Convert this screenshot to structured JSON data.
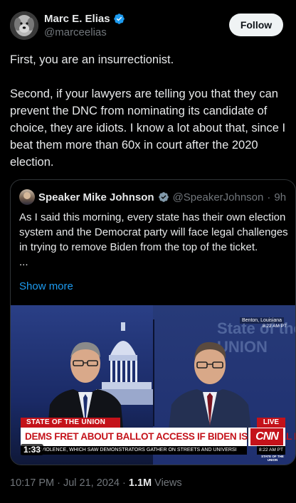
{
  "author": {
    "name": "Marc E. Elias",
    "handle": "@marceelias",
    "verified": true,
    "avatar_icon": "dog-avatar-icon"
  },
  "follow_label": "Follow",
  "tweet": {
    "paragraphs": [
      "First, you are an insurrectionist.",
      "Second, if your lawyers are telling you that they can prevent the DNC from nominating its candidate of choice, they are idiots. I know a lot about that, since I beat them more than 60x in court after the 2020 election."
    ]
  },
  "quote": {
    "name": "Speaker Mike Johnson",
    "handle": "@SpeakerJohnson",
    "separator": "·",
    "age": "9h",
    "text": "As I said this morning, every state has their own election system and the Democrat party will face legal challenges in trying to remove Biden from the top of the ticket.",
    "ellipsis": "...",
    "show_more": "Show more",
    "video": {
      "location": "Benton, Louisiana",
      "small_time": "8:22 AM PT",
      "bg_text": "State of the UNION",
      "show_tag": "STATE OF THE UNION",
      "live_tag": "LIVE",
      "headline": "DEMS FRET ABOUT BALLOT ACCESS IF BIDEN ISN'T FINAL NOMINEE",
      "network": "CNN",
      "ticker": "N THE VIOLENCE, WHICH SAW DEMONSTRATORS GATHER ON STREETS AND UNIVERSI",
      "ticker_time": "8:22 AM PT",
      "sotu_small": "STATE OF THE UNION",
      "duration": "1:33"
    }
  },
  "meta": {
    "time": "10:17 PM",
    "date": "Jul 21, 2024",
    "views_count": "1.1M",
    "views_label": "Views"
  },
  "colors": {
    "background": "#000000",
    "text": "#e7e9ea",
    "muted": "#71767b",
    "link": "#1d9bf0",
    "verified": "#1d9bf0",
    "cnn_red": "#c4121a"
  }
}
